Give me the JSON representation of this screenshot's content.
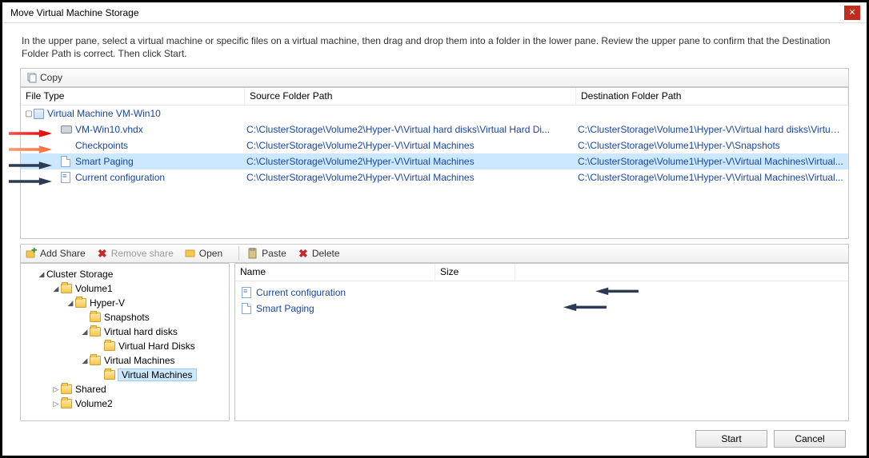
{
  "window": {
    "title": "Move Virtual Machine Storage"
  },
  "instructions": "In the upper pane, select a virtual machine or specific files on a virtual machine, then drag and drop them into a folder in the lower pane.  Review the upper pane to confirm that the Destination Folder Path is correct. Then click Start.",
  "upper_toolbar": {
    "copy": "Copy"
  },
  "columns": {
    "file_type": "File Type",
    "source": "Source Folder Path",
    "destination": "Destination Folder Path"
  },
  "vm_row": {
    "label": "Virtual Machine VM-Win10"
  },
  "rows": [
    {
      "ft": "VM-Win10.vhdx",
      "src": "C:\\ClusterStorage\\Volume2\\Hyper-V\\Virtual hard disks\\Virtual Hard Di...",
      "dst": "C:\\ClusterStorage\\Volume1\\Hyper-V\\Virtual hard disks\\Virtual..."
    },
    {
      "ft": "Checkpoints",
      "src": "C:\\ClusterStorage\\Volume2\\Hyper-V\\Virtual Machines",
      "dst": "C:\\ClusterStorage\\Volume1\\Hyper-V\\Snapshots"
    },
    {
      "ft": "Smart Paging",
      "src": "C:\\ClusterStorage\\Volume2\\Hyper-V\\Virtual Machines",
      "dst": "C:\\ClusterStorage\\Volume1\\Hyper-V\\Virtual Machines\\Virtual..."
    },
    {
      "ft": "Current configuration",
      "src": "C:\\ClusterStorage\\Volume2\\Hyper-V\\Virtual Machines",
      "dst": "C:\\ClusterStorage\\Volume1\\Hyper-V\\Virtual Machines\\Virtual..."
    }
  ],
  "lower_toolbar": {
    "add_share": "Add Share",
    "remove_share": "Remove share",
    "open": "Open",
    "paste": "Paste",
    "delete": "Delete"
  },
  "tree": {
    "root": "Cluster Storage",
    "vol1": "Volume1",
    "hyperv": "Hyper-V",
    "snapshots": "Snapshots",
    "vhd": "Virtual hard disks",
    "vhd_child": "Virtual Hard Disks",
    "vms": "Virtual Machines",
    "vms_child": "Virtual Machines",
    "shared": "Shared",
    "vol2": "Volume2"
  },
  "list_columns": {
    "name": "Name",
    "size": "Size"
  },
  "list_rows": [
    {
      "name": "Current configuration"
    },
    {
      "name": "Smart Paging"
    }
  ],
  "buttons": {
    "start": "Start",
    "cancel": "Cancel"
  }
}
